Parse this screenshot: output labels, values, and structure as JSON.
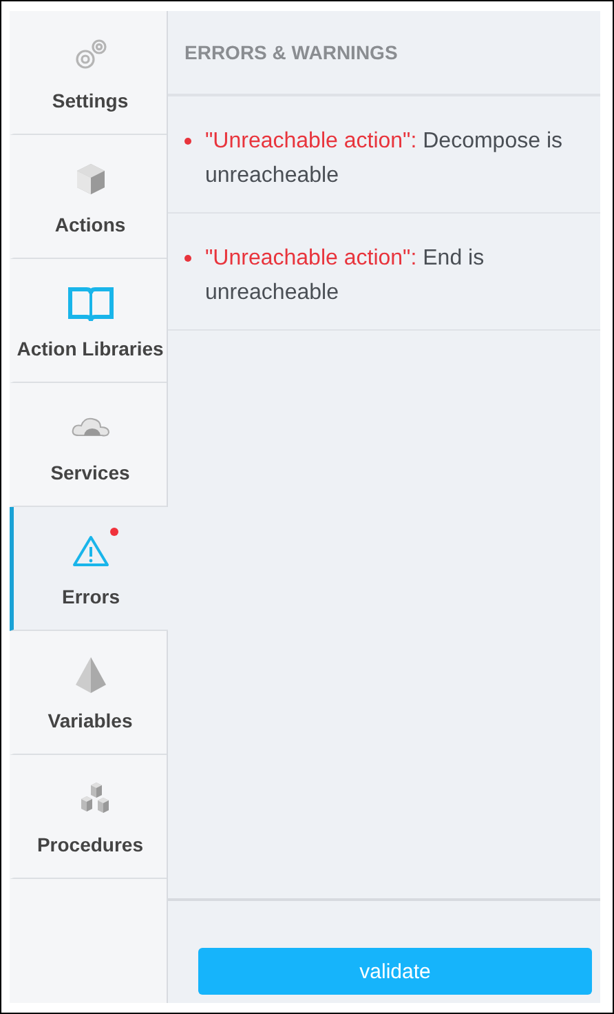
{
  "sidebar": {
    "items": [
      {
        "label": "Settings",
        "kind": "gears",
        "selected": false,
        "badge": false
      },
      {
        "label": "Actions",
        "kind": "cube",
        "selected": false,
        "badge": false
      },
      {
        "label": "Action Libraries",
        "kind": "book",
        "selected": false,
        "badge": false
      },
      {
        "label": "Services",
        "kind": "cloud",
        "selected": false,
        "badge": false
      },
      {
        "label": "Errors",
        "kind": "warning",
        "selected": true,
        "badge": true
      },
      {
        "label": "Variables",
        "kind": "pyramid",
        "selected": false,
        "badge": false
      },
      {
        "label": "Procedures",
        "kind": "cubes",
        "selected": false,
        "badge": false
      }
    ]
  },
  "panel": {
    "title": "ERRORS & WARNINGS",
    "errors": [
      {
        "title": "\"Unreachable action\":",
        "message": "Decompose is unreacheable"
      },
      {
        "title": "\"Unreachable action\":",
        "message": "End is unreacheable"
      }
    ],
    "button": "validate"
  }
}
